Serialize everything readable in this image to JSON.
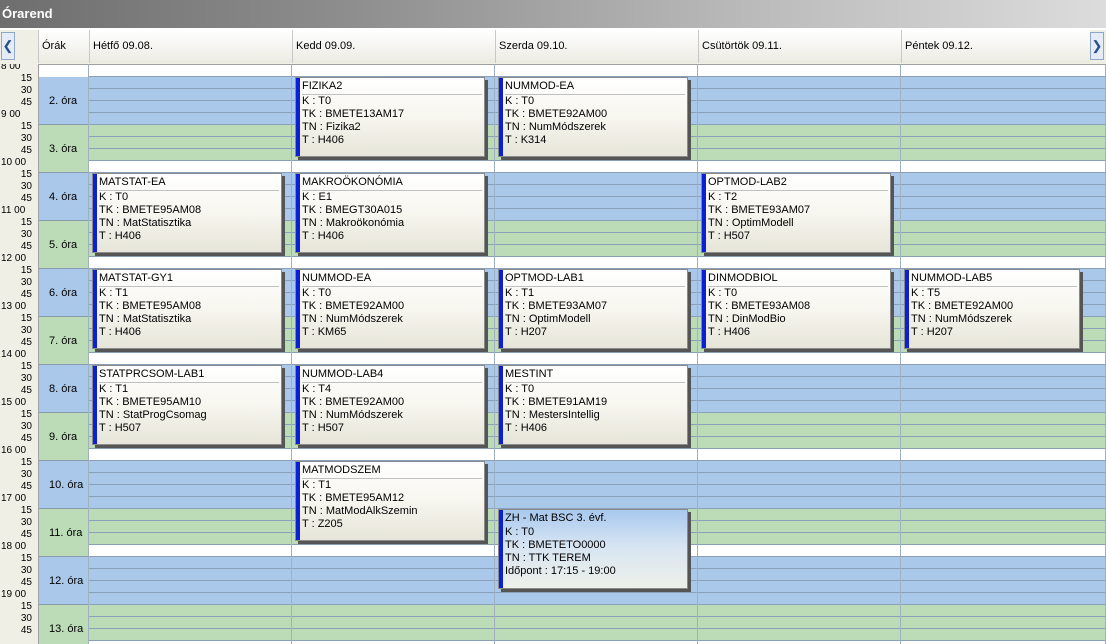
{
  "window": {
    "title": "Órarend"
  },
  "header": {
    "slot_col": "Órák",
    "days": [
      "Hétfő  09.08.",
      "Kedd  09.09.",
      "Szerda  09.10.",
      "Csütörtök  09.11.",
      "Péntek  09.12."
    ]
  },
  "time_gutter": {
    "hours": [
      "8 00",
      "9 00",
      "10 00",
      "11 00",
      "12 00",
      "13 00",
      "14 00",
      "15 00",
      "16 00",
      "17 00",
      "18 00",
      "19 00"
    ],
    "minutes": [
      "15",
      "30",
      "45"
    ]
  },
  "slots": [
    "2. óra",
    "3. óra",
    "4. óra",
    "5. óra",
    "6. óra",
    "7. óra",
    "8. óra",
    "9. óra",
    "10. óra",
    "11. óra",
    "12. óra",
    "13. óra"
  ],
  "events": [
    {
      "day": 1,
      "start": 1,
      "end": 8,
      "title": "FIZIKA2",
      "lines": [
        "K : T0",
        "TK : BMETE13AM17",
        "TN : Fizika2",
        "T : H406"
      ]
    },
    {
      "day": 2,
      "start": 1,
      "end": 8,
      "title": "NUMMOD-EA",
      "lines": [
        "K : T0",
        "TK : BMETE92AM00",
        "TN : NumMódszerek",
        "T : K314"
      ]
    },
    {
      "day": 0,
      "start": 9,
      "end": 16,
      "title": "MATSTAT-EA",
      "lines": [
        "K : T0",
        "TK : BMETE95AM08",
        "TN : MatStatisztika",
        "T : H406"
      ]
    },
    {
      "day": 1,
      "start": 9,
      "end": 16,
      "title": "MAKROÖKONÓMIA",
      "lines": [
        "K : E1",
        "TK : BMEGT30A015",
        "TN : Makroökonómia",
        "T : H406"
      ]
    },
    {
      "day": 3,
      "start": 9,
      "end": 16,
      "title": "OPTMOD-LAB2",
      "lines": [
        "K : T2",
        "TK : BMETE93AM07",
        "TN : OptimModell",
        "T : H507"
      ]
    },
    {
      "day": 0,
      "start": 17,
      "end": 24,
      "title": "MATSTAT-GY1",
      "lines": [
        "K : T1",
        "TK : BMETE95AM08",
        "TN : MatStatisztika",
        "T : H406"
      ]
    },
    {
      "day": 1,
      "start": 17,
      "end": 24,
      "title": "NUMMOD-EA",
      "lines": [
        "K : T0",
        "TK : BMETE92AM00",
        "TN : NumMódszerek",
        "T : KM65"
      ]
    },
    {
      "day": 2,
      "start": 17,
      "end": 24,
      "title": "OPTMOD-LAB1",
      "lines": [
        "K : T1",
        "TK : BMETE93AM07",
        "TN : OptimModell",
        "T : H207"
      ]
    },
    {
      "day": 3,
      "start": 17,
      "end": 24,
      "title": "DINMODBIOL",
      "lines": [
        "K : T0",
        "TK : BMETE93AM08",
        "TN : DinModBio",
        "T : H406"
      ]
    },
    {
      "day": 4,
      "start": 17,
      "end": 24,
      "title": "NUMMOD-LAB5",
      "lines": [
        "K : T5",
        "TK : BMETE92AM00",
        "TN : NumMódszerek",
        "T : H207"
      ]
    },
    {
      "day": 0,
      "start": 25,
      "end": 32,
      "title": "STATPRCSOM-LAB1",
      "lines": [
        "K : T1",
        "TK : BMETE95AM10",
        "TN : StatProgCsomag",
        "T : H507"
      ]
    },
    {
      "day": 1,
      "start": 25,
      "end": 32,
      "title": "NUMMOD-LAB4",
      "lines": [
        "K : T4",
        "TK : BMETE92AM00",
        "TN : NumMódszerek",
        "T : H507"
      ]
    },
    {
      "day": 2,
      "start": 25,
      "end": 32,
      "title": "MESTINT",
      "lines": [
        "K : T0",
        "TK : BMETE91AM19",
        "TN : MestersIntellig",
        "T : H406"
      ]
    },
    {
      "day": 1,
      "start": 33,
      "end": 40,
      "title": "MATMODSZEM",
      "lines": [
        "K : T1",
        "TK : BMETE95AM12",
        "TN : MatModAlkSzemin",
        "T : Z205"
      ]
    },
    {
      "day": 2,
      "start": 37,
      "end": 44,
      "title": "ZH - Mat BSC 3. évf.",
      "zh": true,
      "lines": [
        "K : T0",
        "TK : BMETETO0000",
        "TN : TTK TEREM",
        "Időpont : 17:15 - 19:00"
      ]
    }
  ],
  "colors": {
    "blue_band": "#a9c8ea",
    "green_band": "#bcdcb8",
    "event_bar": "#0b1fd6"
  }
}
